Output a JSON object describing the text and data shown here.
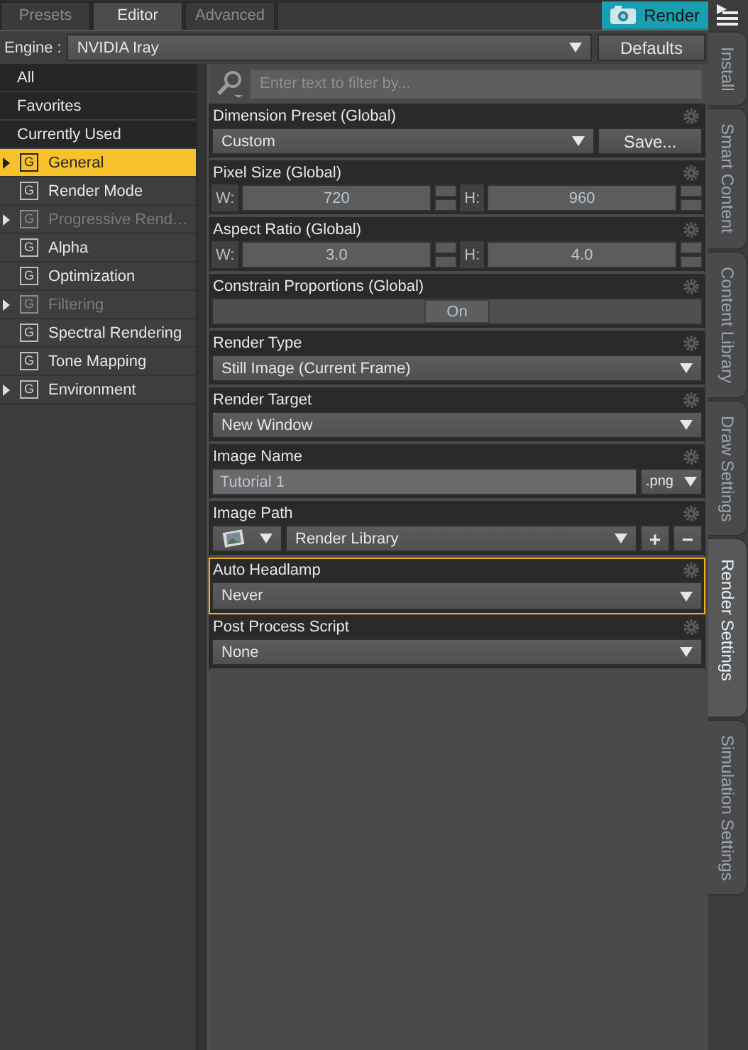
{
  "top_tabs": [
    {
      "label": "Presets",
      "selected": false
    },
    {
      "label": "Editor",
      "selected": true
    },
    {
      "label": "Advanced",
      "selected": false
    }
  ],
  "render_button": {
    "label": "Render"
  },
  "engine": {
    "label": "Engine :",
    "value": "NVIDIA Iray"
  },
  "defaults_button": {
    "label": "Defaults"
  },
  "sidebar": {
    "items": [
      {
        "label": "All",
        "kind": "filter",
        "selected": false
      },
      {
        "label": "Favorites",
        "kind": "filter",
        "selected": false
      },
      {
        "label": "Currently Used",
        "kind": "filter",
        "selected": false
      },
      {
        "label": "General",
        "kind": "group",
        "badge": "G",
        "expandable": true,
        "disabled": false,
        "selected": true
      },
      {
        "label": "Render Mode",
        "kind": "group",
        "badge": "G",
        "expandable": false,
        "disabled": false,
        "selected": false
      },
      {
        "label": "Progressive Rend…",
        "kind": "group",
        "badge": "G",
        "expandable": true,
        "disabled": true,
        "selected": false
      },
      {
        "label": "Alpha",
        "kind": "group",
        "badge": "G",
        "expandable": false,
        "disabled": false,
        "selected": false
      },
      {
        "label": "Optimization",
        "kind": "group",
        "badge": "G",
        "expandable": false,
        "disabled": false,
        "selected": false
      },
      {
        "label": "Filtering",
        "kind": "group",
        "badge": "G",
        "expandable": true,
        "disabled": true,
        "selected": false
      },
      {
        "label": "Spectral Rendering",
        "kind": "group",
        "badge": "G",
        "expandable": false,
        "disabled": false,
        "selected": false
      },
      {
        "label": "Tone Mapping",
        "kind": "group",
        "badge": "G",
        "expandable": false,
        "disabled": false,
        "selected": false
      },
      {
        "label": "Environment",
        "kind": "group",
        "badge": "G",
        "expandable": true,
        "disabled": false,
        "selected": false
      }
    ]
  },
  "filter": {
    "placeholder": "Enter text to filter by..."
  },
  "properties": [
    {
      "label": "Dimension Preset (Global)",
      "kind": "dropdown",
      "value": "Custom",
      "button": "Save...",
      "selected": false
    },
    {
      "label": "Pixel Size (Global)",
      "kind": "pair",
      "w_label": "W:",
      "w_value": "720",
      "h_label": "H:",
      "h_value": "960",
      "selected": false
    },
    {
      "label": "Aspect Ratio (Global)",
      "kind": "pair",
      "w_label": "W:",
      "w_value": "3.0",
      "h_label": "H:",
      "h_value": "4.0",
      "selected": false
    },
    {
      "label": "Constrain Proportions (Global)",
      "kind": "toggle",
      "value": "On",
      "on": true,
      "selected": false
    },
    {
      "label": "Render Type",
      "kind": "dropdown",
      "value": "Still Image (Current Frame)",
      "selected": false
    },
    {
      "label": "Render Target",
      "kind": "dropdown",
      "value": "New Window",
      "selected": false
    },
    {
      "label": "Image Name",
      "kind": "name",
      "value": "Tutorial 1",
      "format": ".png",
      "selected": false
    },
    {
      "label": "Image Path",
      "kind": "path",
      "value": "Render Library",
      "add": "+",
      "remove": "−",
      "selected": false
    },
    {
      "label": "Auto Headlamp",
      "kind": "dropdown",
      "value": "Never",
      "selected": true
    },
    {
      "label": "Post Process Script",
      "kind": "dropdown",
      "value": "None",
      "selected": false
    }
  ],
  "side_tabs": [
    {
      "label": "Install",
      "selected": false
    },
    {
      "label": "Smart Content",
      "selected": false
    },
    {
      "label": "Content Library",
      "selected": false
    },
    {
      "label": "Draw Settings",
      "selected": false
    },
    {
      "label": "Render Settings",
      "selected": true
    },
    {
      "label": "Simulation Settings",
      "selected": false
    }
  ]
}
